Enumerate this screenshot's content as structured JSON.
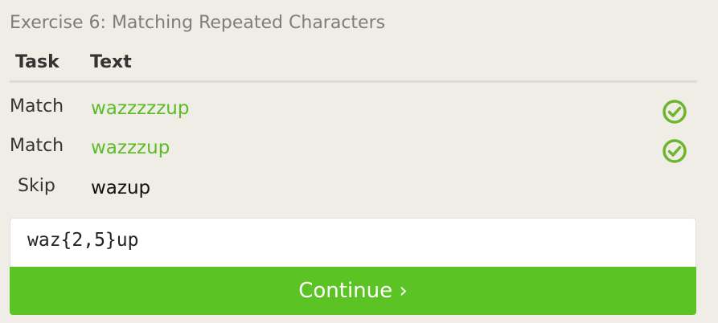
{
  "exercise": {
    "title": "Exercise 6: Matching Repeated Characters"
  },
  "table": {
    "headers": {
      "task": "Task",
      "text": "Text"
    },
    "rows": [
      {
        "task": "Match",
        "text": "wazzzzzup",
        "status": "passed"
      },
      {
        "task": "Match",
        "text": "wazzzup",
        "status": "passed"
      },
      {
        "task": "Skip",
        "text": "wazup",
        "status": "none"
      }
    ]
  },
  "answer": {
    "value": "waz{2,5}up"
  },
  "continue_button": {
    "label": "Continue ›"
  },
  "colors": {
    "success": "#5bbb28",
    "button": "#5cc324",
    "background": "#efede5"
  },
  "icons": {
    "check": "check-circle-icon"
  }
}
